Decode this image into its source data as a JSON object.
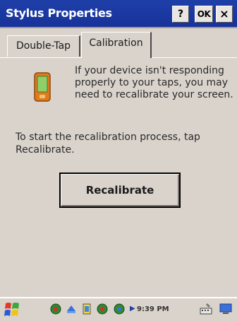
{
  "window": {
    "title": "Stylus Properties",
    "help_label": "?",
    "ok_label": "OK",
    "close_label": "×"
  },
  "tabs": [
    {
      "label": "Double-Tap",
      "selected": false
    },
    {
      "label": "Calibration",
      "selected": true
    }
  ],
  "calibration": {
    "info_text": "If your device isn't responding properly to your taps, you may need to recalibrate your screen.",
    "instruction_text": "To start the recalibration process, tap Recalibrate.",
    "recalibrate_label": "Recalibrate"
  },
  "taskbar": {
    "clock": "9:39 PM",
    "start_icon": "windows-start-icon",
    "tray_icons": [
      "network-icon",
      "bluetooth-icon",
      "battery-icon",
      "wireless-icon",
      "sync-icon"
    ],
    "right_icons": [
      "input-panel-icon",
      "desktop-icon"
    ]
  },
  "colors": {
    "titlebar": "#1f3fa8",
    "background": "#d9d3cc"
  }
}
